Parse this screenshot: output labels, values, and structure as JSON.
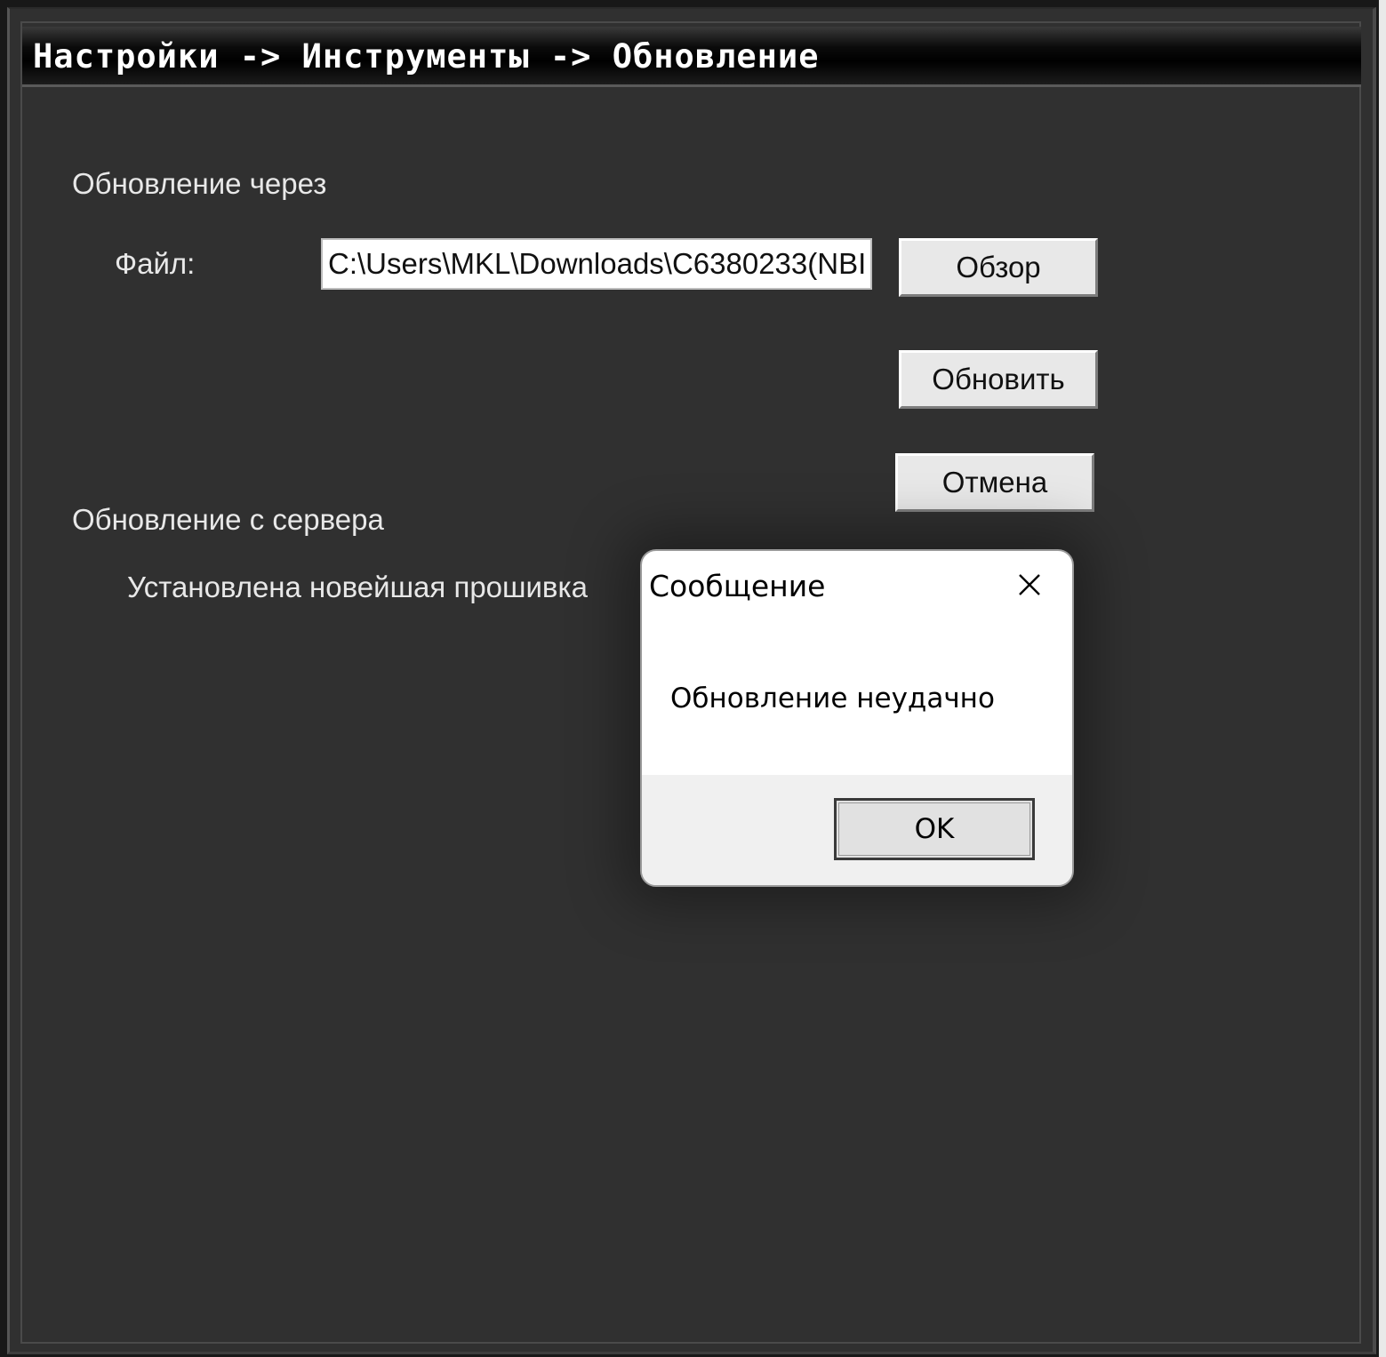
{
  "window": {
    "title": "Настройки -> Инструменты -> Обновление"
  },
  "update_via": {
    "section_label": "Обновление через",
    "file_label": "Файл:",
    "file_path_value": "C:\\Users\\MKL\\Downloads\\C6380233(NBI",
    "browse_label": "Обзор",
    "update_label": "Обновить",
    "cancel_label": "Отмена"
  },
  "update_from_server": {
    "section_label": "Обновление с сервера",
    "status_text": "Установлена новейшая прошивка"
  },
  "message_dialog": {
    "title": "Сообщение",
    "close_icon": "close-icon",
    "message": "Обновление неудачно",
    "ok_label": "OK"
  }
}
